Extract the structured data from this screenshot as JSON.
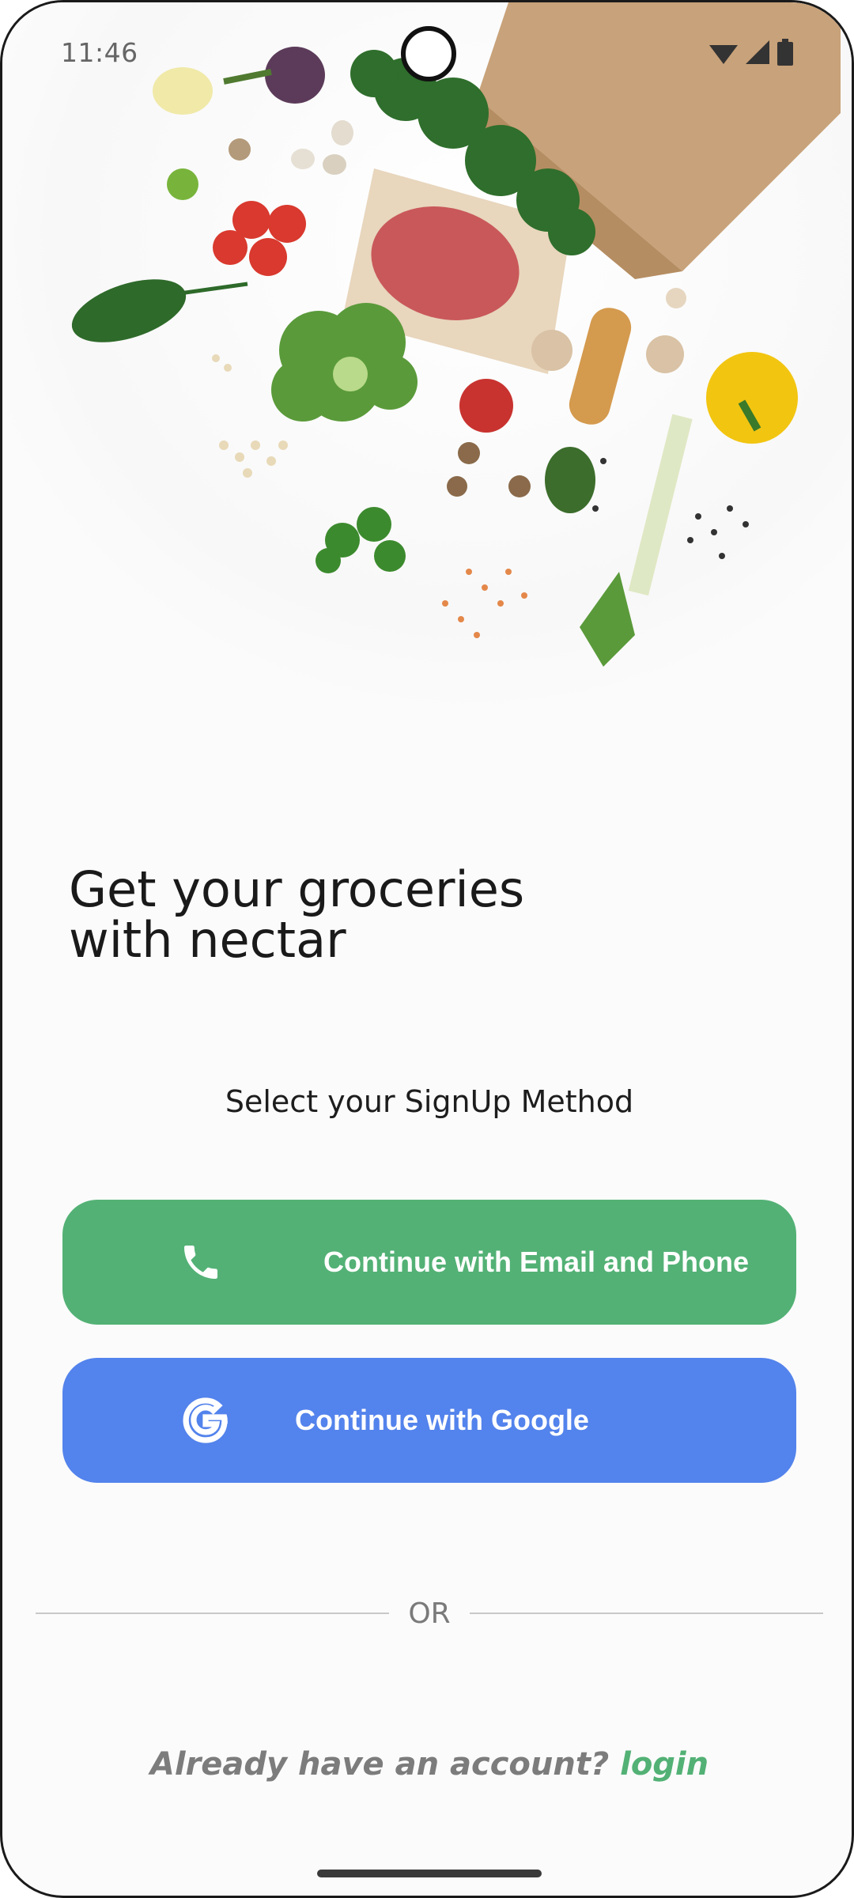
{
  "status_bar": {
    "time": "11:46",
    "icons": [
      "wifi-icon",
      "cellular-signal-icon",
      "battery-icon"
    ]
  },
  "hero": {
    "image_name": "groceries-hero-image"
  },
  "headline": "Get your groceries\nwith nectar",
  "subtitle": "Select your SignUp Method",
  "buttons": {
    "email_phone": {
      "label": "Continue with Email and Phone",
      "icon": "phone-icon",
      "color": "#53b175"
    },
    "google": {
      "label": "Continue with Google",
      "icon": "google-icon",
      "color": "#5383ec"
    }
  },
  "divider": {
    "label": "OR"
  },
  "login": {
    "prompt": "Already have an account?",
    "link": "login",
    "link_color": "#53b175"
  }
}
